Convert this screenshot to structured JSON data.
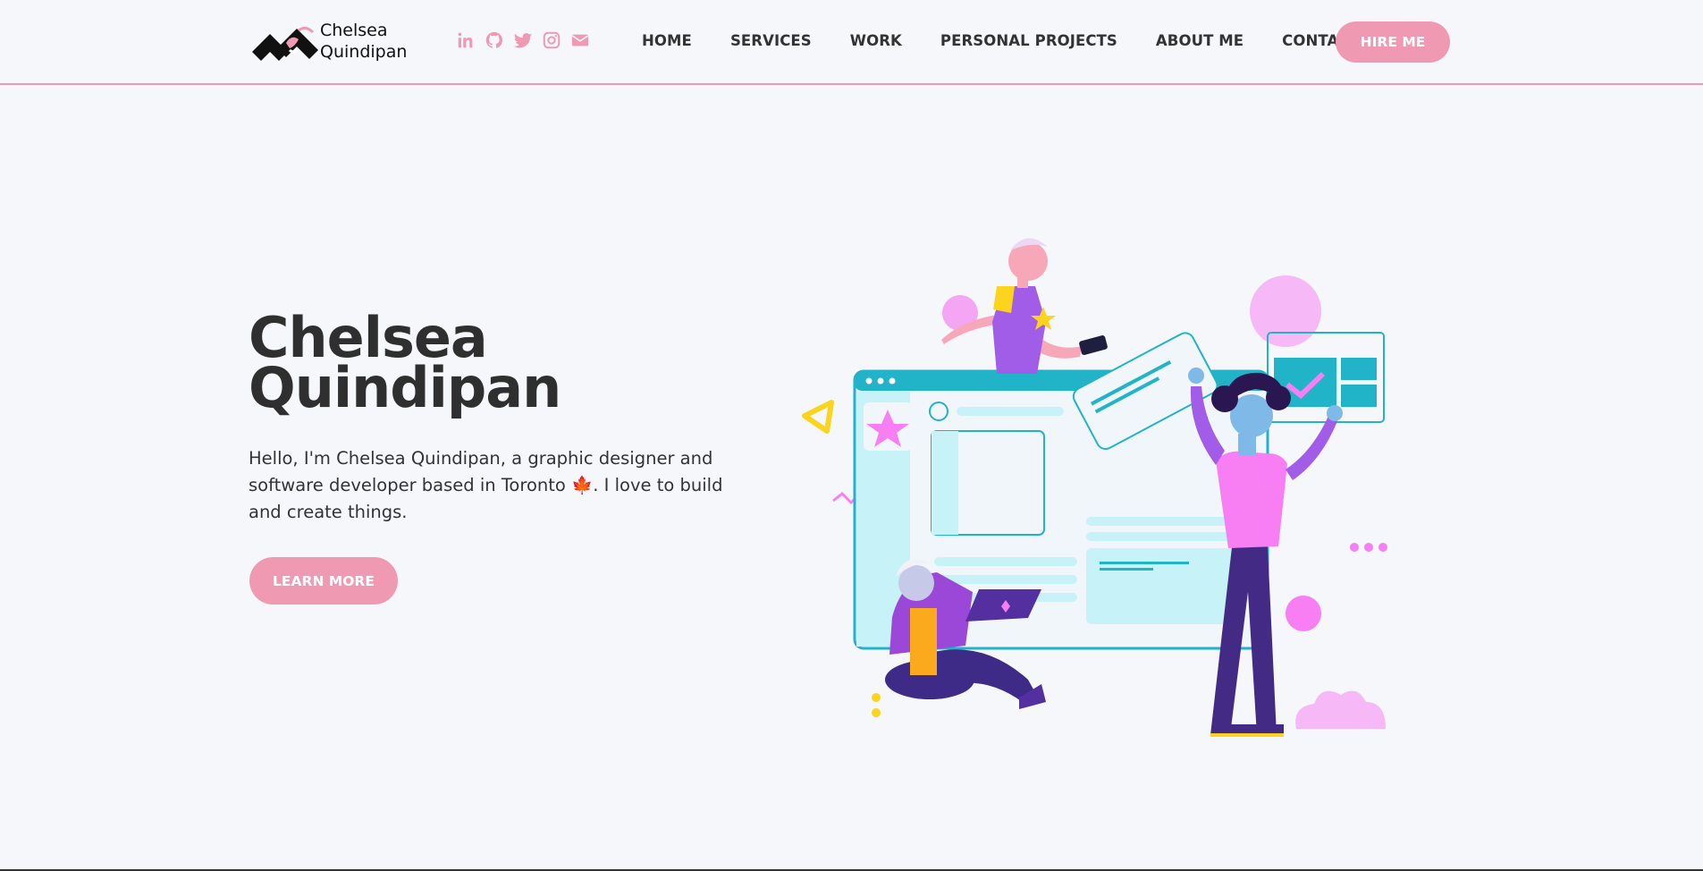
{
  "logo": {
    "line1": "Chelsea",
    "line2": "Quindipan"
  },
  "socials": [
    {
      "icon": "linkedin-icon",
      "label": "in"
    },
    {
      "icon": "github-icon"
    },
    {
      "icon": "twitter-icon"
    },
    {
      "icon": "instagram-icon"
    },
    {
      "icon": "envelope-icon"
    }
  ],
  "nav": {
    "home": "HOME",
    "services": "SERVICES",
    "work": "WORK",
    "personal_projects": "PERSONAL PROJECTS",
    "about": "ABOUT ME",
    "contact": "CONTACT"
  },
  "hire_label": "HIRE ME",
  "hero": {
    "title_line1": "Chelsea",
    "title_line2": "Quindipan",
    "intro": "Hello, I'm Chelsea Quindipan, a graphic designer and software developer based in Toronto 🍁. I love to build and create things.",
    "cta": "LEARN MORE"
  },
  "colors": {
    "accent": "#ef9ab2",
    "background": "#f6f7fb",
    "text": "#333333"
  }
}
